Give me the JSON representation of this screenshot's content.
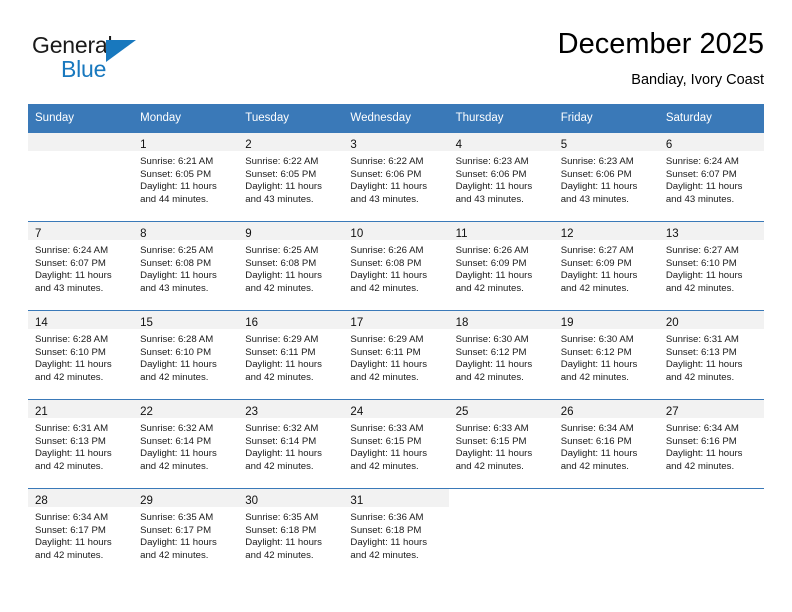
{
  "brand": {
    "name_part1": "General",
    "name_part2": "Blue",
    "flag_icon": "blue-triangle-flag-icon"
  },
  "header": {
    "title": "December 2025",
    "subtitle": "Bandiay, Ivory Coast"
  },
  "colors": {
    "header_blue": "#3a79b8",
    "brand_blue": "#1878be",
    "daynum_band": "#f2f2f2",
    "text": "#1a1a1a"
  },
  "weekday_headers": [
    "Sunday",
    "Monday",
    "Tuesday",
    "Wednesday",
    "Thursday",
    "Friday",
    "Saturday"
  ],
  "weeks": [
    [
      {
        "day": "",
        "sunrise": "",
        "sunset": "",
        "daylight1": "",
        "daylight2": "",
        "empty": true,
        "shaded": true
      },
      {
        "day": "1",
        "sunrise": "Sunrise: 6:21 AM",
        "sunset": "Sunset: 6:05 PM",
        "daylight1": "Daylight: 11 hours",
        "daylight2": "and 44 minutes."
      },
      {
        "day": "2",
        "sunrise": "Sunrise: 6:22 AM",
        "sunset": "Sunset: 6:05 PM",
        "daylight1": "Daylight: 11 hours",
        "daylight2": "and 43 minutes."
      },
      {
        "day": "3",
        "sunrise": "Sunrise: 6:22 AM",
        "sunset": "Sunset: 6:06 PM",
        "daylight1": "Daylight: 11 hours",
        "daylight2": "and 43 minutes."
      },
      {
        "day": "4",
        "sunrise": "Sunrise: 6:23 AM",
        "sunset": "Sunset: 6:06 PM",
        "daylight1": "Daylight: 11 hours",
        "daylight2": "and 43 minutes."
      },
      {
        "day": "5",
        "sunrise": "Sunrise: 6:23 AM",
        "sunset": "Sunset: 6:06 PM",
        "daylight1": "Daylight: 11 hours",
        "daylight2": "and 43 minutes."
      },
      {
        "day": "6",
        "sunrise": "Sunrise: 6:24 AM",
        "sunset": "Sunset: 6:07 PM",
        "daylight1": "Daylight: 11 hours",
        "daylight2": "and 43 minutes."
      }
    ],
    [
      {
        "day": "7",
        "sunrise": "Sunrise: 6:24 AM",
        "sunset": "Sunset: 6:07 PM",
        "daylight1": "Daylight: 11 hours",
        "daylight2": "and 43 minutes."
      },
      {
        "day": "8",
        "sunrise": "Sunrise: 6:25 AM",
        "sunset": "Sunset: 6:08 PM",
        "daylight1": "Daylight: 11 hours",
        "daylight2": "and 43 minutes."
      },
      {
        "day": "9",
        "sunrise": "Sunrise: 6:25 AM",
        "sunset": "Sunset: 6:08 PM",
        "daylight1": "Daylight: 11 hours",
        "daylight2": "and 42 minutes."
      },
      {
        "day": "10",
        "sunrise": "Sunrise: 6:26 AM",
        "sunset": "Sunset: 6:08 PM",
        "daylight1": "Daylight: 11 hours",
        "daylight2": "and 42 minutes."
      },
      {
        "day": "11",
        "sunrise": "Sunrise: 6:26 AM",
        "sunset": "Sunset: 6:09 PM",
        "daylight1": "Daylight: 11 hours",
        "daylight2": "and 42 minutes."
      },
      {
        "day": "12",
        "sunrise": "Sunrise: 6:27 AM",
        "sunset": "Sunset: 6:09 PM",
        "daylight1": "Daylight: 11 hours",
        "daylight2": "and 42 minutes."
      },
      {
        "day": "13",
        "sunrise": "Sunrise: 6:27 AM",
        "sunset": "Sunset: 6:10 PM",
        "daylight1": "Daylight: 11 hours",
        "daylight2": "and 42 minutes."
      }
    ],
    [
      {
        "day": "14",
        "sunrise": "Sunrise: 6:28 AM",
        "sunset": "Sunset: 6:10 PM",
        "daylight1": "Daylight: 11 hours",
        "daylight2": "and 42 minutes."
      },
      {
        "day": "15",
        "sunrise": "Sunrise: 6:28 AM",
        "sunset": "Sunset: 6:10 PM",
        "daylight1": "Daylight: 11 hours",
        "daylight2": "and 42 minutes."
      },
      {
        "day": "16",
        "sunrise": "Sunrise: 6:29 AM",
        "sunset": "Sunset: 6:11 PM",
        "daylight1": "Daylight: 11 hours",
        "daylight2": "and 42 minutes."
      },
      {
        "day": "17",
        "sunrise": "Sunrise: 6:29 AM",
        "sunset": "Sunset: 6:11 PM",
        "daylight1": "Daylight: 11 hours",
        "daylight2": "and 42 minutes."
      },
      {
        "day": "18",
        "sunrise": "Sunrise: 6:30 AM",
        "sunset": "Sunset: 6:12 PM",
        "daylight1": "Daylight: 11 hours",
        "daylight2": "and 42 minutes."
      },
      {
        "day": "19",
        "sunrise": "Sunrise: 6:30 AM",
        "sunset": "Sunset: 6:12 PM",
        "daylight1": "Daylight: 11 hours",
        "daylight2": "and 42 minutes."
      },
      {
        "day": "20",
        "sunrise": "Sunrise: 6:31 AM",
        "sunset": "Sunset: 6:13 PM",
        "daylight1": "Daylight: 11 hours",
        "daylight2": "and 42 minutes."
      }
    ],
    [
      {
        "day": "21",
        "sunrise": "Sunrise: 6:31 AM",
        "sunset": "Sunset: 6:13 PM",
        "daylight1": "Daylight: 11 hours",
        "daylight2": "and 42 minutes."
      },
      {
        "day": "22",
        "sunrise": "Sunrise: 6:32 AM",
        "sunset": "Sunset: 6:14 PM",
        "daylight1": "Daylight: 11 hours",
        "daylight2": "and 42 minutes."
      },
      {
        "day": "23",
        "sunrise": "Sunrise: 6:32 AM",
        "sunset": "Sunset: 6:14 PM",
        "daylight1": "Daylight: 11 hours",
        "daylight2": "and 42 minutes."
      },
      {
        "day": "24",
        "sunrise": "Sunrise: 6:33 AM",
        "sunset": "Sunset: 6:15 PM",
        "daylight1": "Daylight: 11 hours",
        "daylight2": "and 42 minutes."
      },
      {
        "day": "25",
        "sunrise": "Sunrise: 6:33 AM",
        "sunset": "Sunset: 6:15 PM",
        "daylight1": "Daylight: 11 hours",
        "daylight2": "and 42 minutes."
      },
      {
        "day": "26",
        "sunrise": "Sunrise: 6:34 AM",
        "sunset": "Sunset: 6:16 PM",
        "daylight1": "Daylight: 11 hours",
        "daylight2": "and 42 minutes."
      },
      {
        "day": "27",
        "sunrise": "Sunrise: 6:34 AM",
        "sunset": "Sunset: 6:16 PM",
        "daylight1": "Daylight: 11 hours",
        "daylight2": "and 42 minutes."
      }
    ],
    [
      {
        "day": "28",
        "sunrise": "Sunrise: 6:34 AM",
        "sunset": "Sunset: 6:17 PM",
        "daylight1": "Daylight: 11 hours",
        "daylight2": "and 42 minutes."
      },
      {
        "day": "29",
        "sunrise": "Sunrise: 6:35 AM",
        "sunset": "Sunset: 6:17 PM",
        "daylight1": "Daylight: 11 hours",
        "daylight2": "and 42 minutes."
      },
      {
        "day": "30",
        "sunrise": "Sunrise: 6:35 AM",
        "sunset": "Sunset: 6:18 PM",
        "daylight1": "Daylight: 11 hours",
        "daylight2": "and 42 minutes."
      },
      {
        "day": "31",
        "sunrise": "Sunrise: 6:36 AM",
        "sunset": "Sunset: 6:18 PM",
        "daylight1": "Daylight: 11 hours",
        "daylight2": "and 42 minutes."
      },
      {
        "day": "",
        "sunrise": "",
        "sunset": "",
        "daylight1": "",
        "daylight2": "",
        "empty": true,
        "shaded": false
      },
      {
        "day": "",
        "sunrise": "",
        "sunset": "",
        "daylight1": "",
        "daylight2": "",
        "empty": true,
        "shaded": false
      },
      {
        "day": "",
        "sunrise": "",
        "sunset": "",
        "daylight1": "",
        "daylight2": "",
        "empty": true,
        "shaded": false
      }
    ]
  ]
}
